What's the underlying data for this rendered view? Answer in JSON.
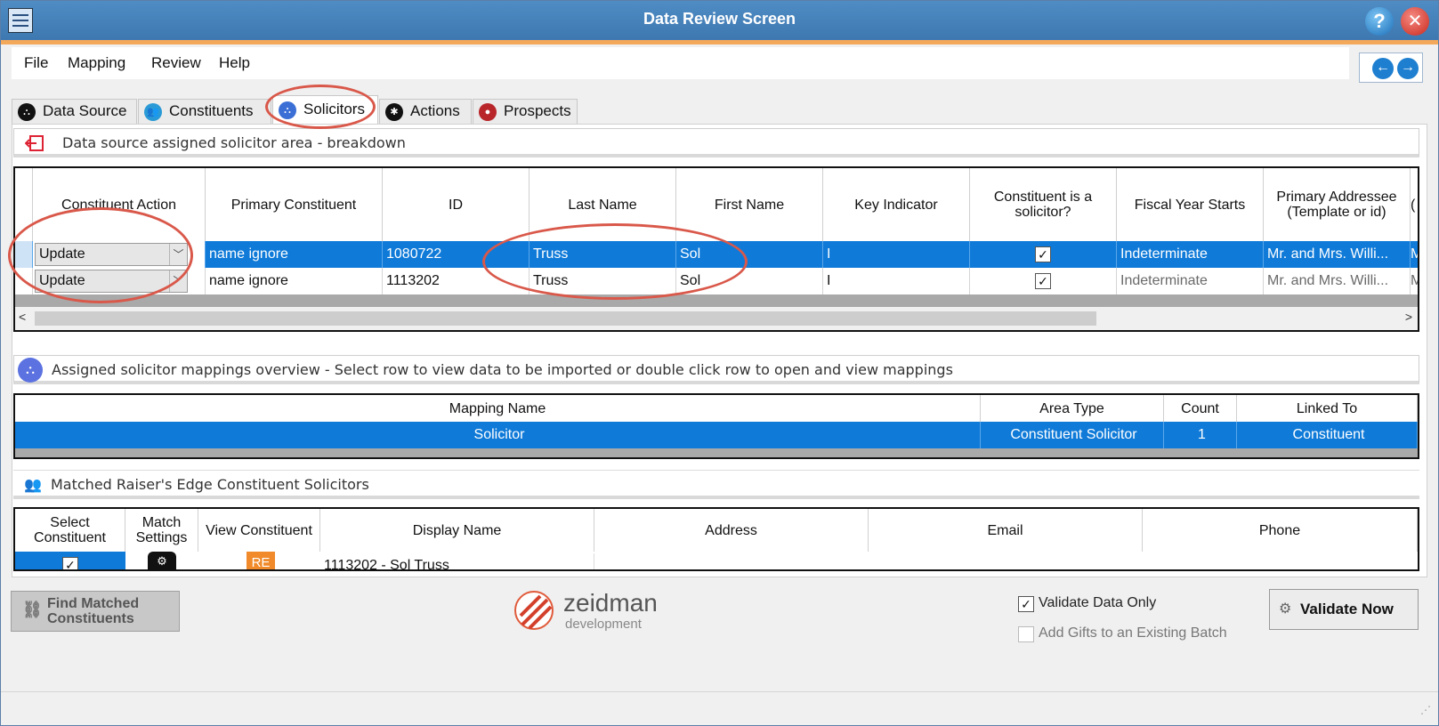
{
  "window": {
    "title": "Data Review Screen"
  },
  "menu": [
    "File",
    "Mapping",
    "Review",
    "Help"
  ],
  "tabs": [
    {
      "label": "Data Source",
      "color": "#111111",
      "icon": "data-source-icon"
    },
    {
      "label": "Constituents",
      "color": "#2a9ad6",
      "icon": "constituents-icon"
    },
    {
      "label": "Solicitors",
      "color": "#3b6fd6",
      "icon": "solicitors-icon",
      "active": true
    },
    {
      "label": "Actions",
      "color": "#111111",
      "icon": "actions-icon"
    },
    {
      "label": "Prospects",
      "color": "#b8262a",
      "icon": "prospects-icon"
    }
  ],
  "solicitor_area": {
    "title": "Data source assigned solicitor area - breakdown",
    "columns": [
      "Constituent Action",
      "Primary Constituent",
      "ID",
      "Last Name",
      "First Name",
      "Key Indicator",
      "Constituent is a solicitor?",
      "Fiscal Year Starts",
      "Primary Addressee (Template or id)",
      "("
    ],
    "rows": [
      {
        "action": "Update",
        "primary": "name ignore",
        "id": "1080722",
        "last": "Truss",
        "first": "Sol",
        "key": "I",
        "is_solicitor": true,
        "fiscal": "Indeterminate",
        "addressee": "Mr. and Mrs. Willi...",
        "extra": "Mr."
      },
      {
        "action": "Update",
        "primary": "name ignore",
        "id": "1113202",
        "last": "Truss",
        "first": "Sol",
        "key": "I",
        "is_solicitor": true,
        "fiscal": "Indeterminate",
        "addressee": "Mr. and Mrs. Willi...",
        "extra": "Mr."
      }
    ]
  },
  "mappings": {
    "title": "Assigned solicitor mappings overview - Select row to view data to be imported or double click row to open and view mappings",
    "columns": [
      "Mapping Name",
      "Area Type",
      "Count",
      "Linked To"
    ],
    "rows": [
      {
        "name": "Solicitor",
        "area": "Constituent Solicitor",
        "count": "1",
        "linked": "Constituent"
      }
    ]
  },
  "matched": {
    "title": "Matched Raiser's Edge Constituent Solicitors",
    "columns": [
      "Select Constituent",
      "Match Settings",
      "View Constituent",
      "Display Name",
      "Address",
      "Email",
      "Phone"
    ],
    "row": {
      "display": "1113202 - Sol Truss",
      "re_badge": "RE"
    }
  },
  "buttons": {
    "find": "Find Matched Constituents",
    "validate": "Validate Now"
  },
  "options": {
    "validate_only": "Validate Data Only",
    "add_gifts": "Add Gifts to an Existing Batch"
  },
  "logo": {
    "name": "zeidman",
    "sub": "development"
  }
}
